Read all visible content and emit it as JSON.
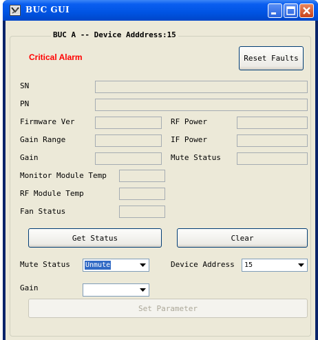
{
  "window": {
    "title": "BUC GUI"
  },
  "group": {
    "title": "BUC A -- Device Adddress:15"
  },
  "alarm": {
    "text": "Critical Alarm",
    "color": "#ff0000"
  },
  "buttons": {
    "reset_faults": "Reset Faults",
    "get_status": "Get Status",
    "clear": "Clear",
    "set_parameter": "Set Parameter"
  },
  "fields": {
    "sn": {
      "label": "SN",
      "value": ""
    },
    "pn": {
      "label": "PN",
      "value": ""
    },
    "firmware_ver": {
      "label": "Firmware Ver",
      "value": ""
    },
    "rf_power": {
      "label": "RF Power",
      "value": ""
    },
    "gain_range": {
      "label": "Gain Range",
      "value": ""
    },
    "if_power": {
      "label": "IF Power",
      "value": ""
    },
    "gain": {
      "label": "Gain",
      "value": ""
    },
    "mute_status": {
      "label": "Mute Status",
      "value": ""
    },
    "monitor_module_temp": {
      "label": "Monitor Module Temp",
      "value": ""
    },
    "rf_module_temp": {
      "label": "RF Module Temp",
      "value": ""
    },
    "fan_status": {
      "label": "Fan Status",
      "value": ""
    }
  },
  "controls": {
    "mute_status": {
      "label": "Mute Status",
      "selected": "Unmute"
    },
    "device_address": {
      "label": "Device Address",
      "selected": "15"
    },
    "gain": {
      "label": "Gain",
      "selected": ""
    }
  },
  "icons": {
    "app": "app-icon",
    "minimize": "minimize-icon",
    "maximize": "maximize-icon",
    "close": "close-icon",
    "dropdown": "chevron-down-icon"
  },
  "colors": {
    "titlebar": "#0054e3",
    "client_bg": "#ece9d8",
    "selection": "#316ac5",
    "close_button": "#c8431b"
  }
}
